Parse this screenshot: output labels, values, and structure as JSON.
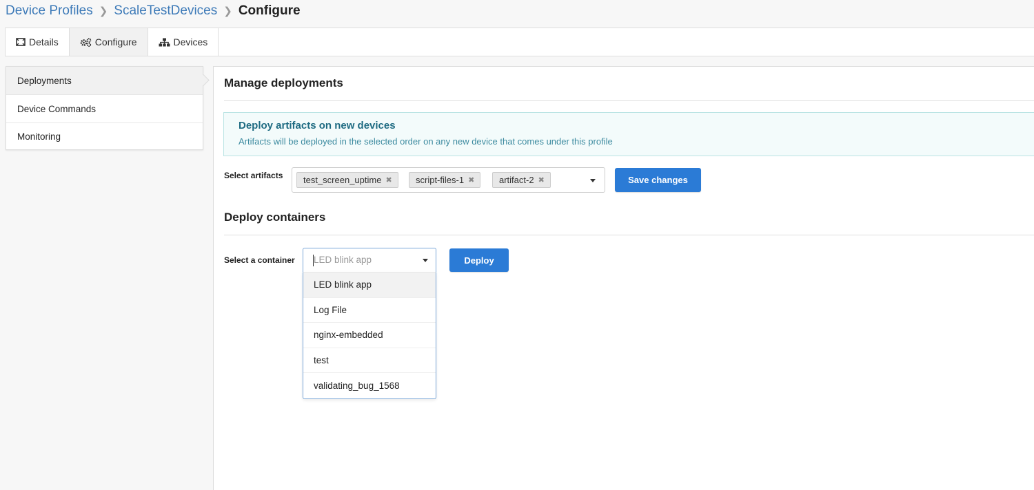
{
  "breadcrumb": {
    "items": [
      "Device Profiles",
      "ScaleTestDevices"
    ],
    "current": "Configure"
  },
  "tabs": [
    {
      "label": "Details",
      "icon": "details-icon"
    },
    {
      "label": "Configure",
      "icon": "cogs-icon",
      "active": true
    },
    {
      "label": "Devices",
      "icon": "sitemap-icon"
    }
  ],
  "sidebar": {
    "items": [
      {
        "label": "Deployments",
        "active": true
      },
      {
        "label": "Device Commands"
      },
      {
        "label": "Monitoring"
      }
    ]
  },
  "main": {
    "title": "Manage deployments",
    "info": {
      "title": "Deploy artifacts on new devices",
      "subtitle": "Artifacts will be deployed in the selected order on any new device that comes under this profile"
    },
    "artifacts": {
      "label": "Select artifacts",
      "selected": [
        "test_screen_uptime",
        "script-files-1",
        "artifact-2"
      ],
      "save_label": "Save changes"
    },
    "containers": {
      "title": "Deploy containers",
      "label": "Select a container",
      "placeholder": "LED blink app",
      "deploy_label": "Deploy",
      "options": [
        "LED blink app",
        "Log File",
        "nginx-embedded",
        "test",
        "validating_bug_1568"
      ]
    }
  },
  "colors": {
    "primary_button": "#2b7bd6",
    "link": "#3d7ab8",
    "info_bg": "#f3fbfb",
    "info_title": "#1e6b82"
  }
}
